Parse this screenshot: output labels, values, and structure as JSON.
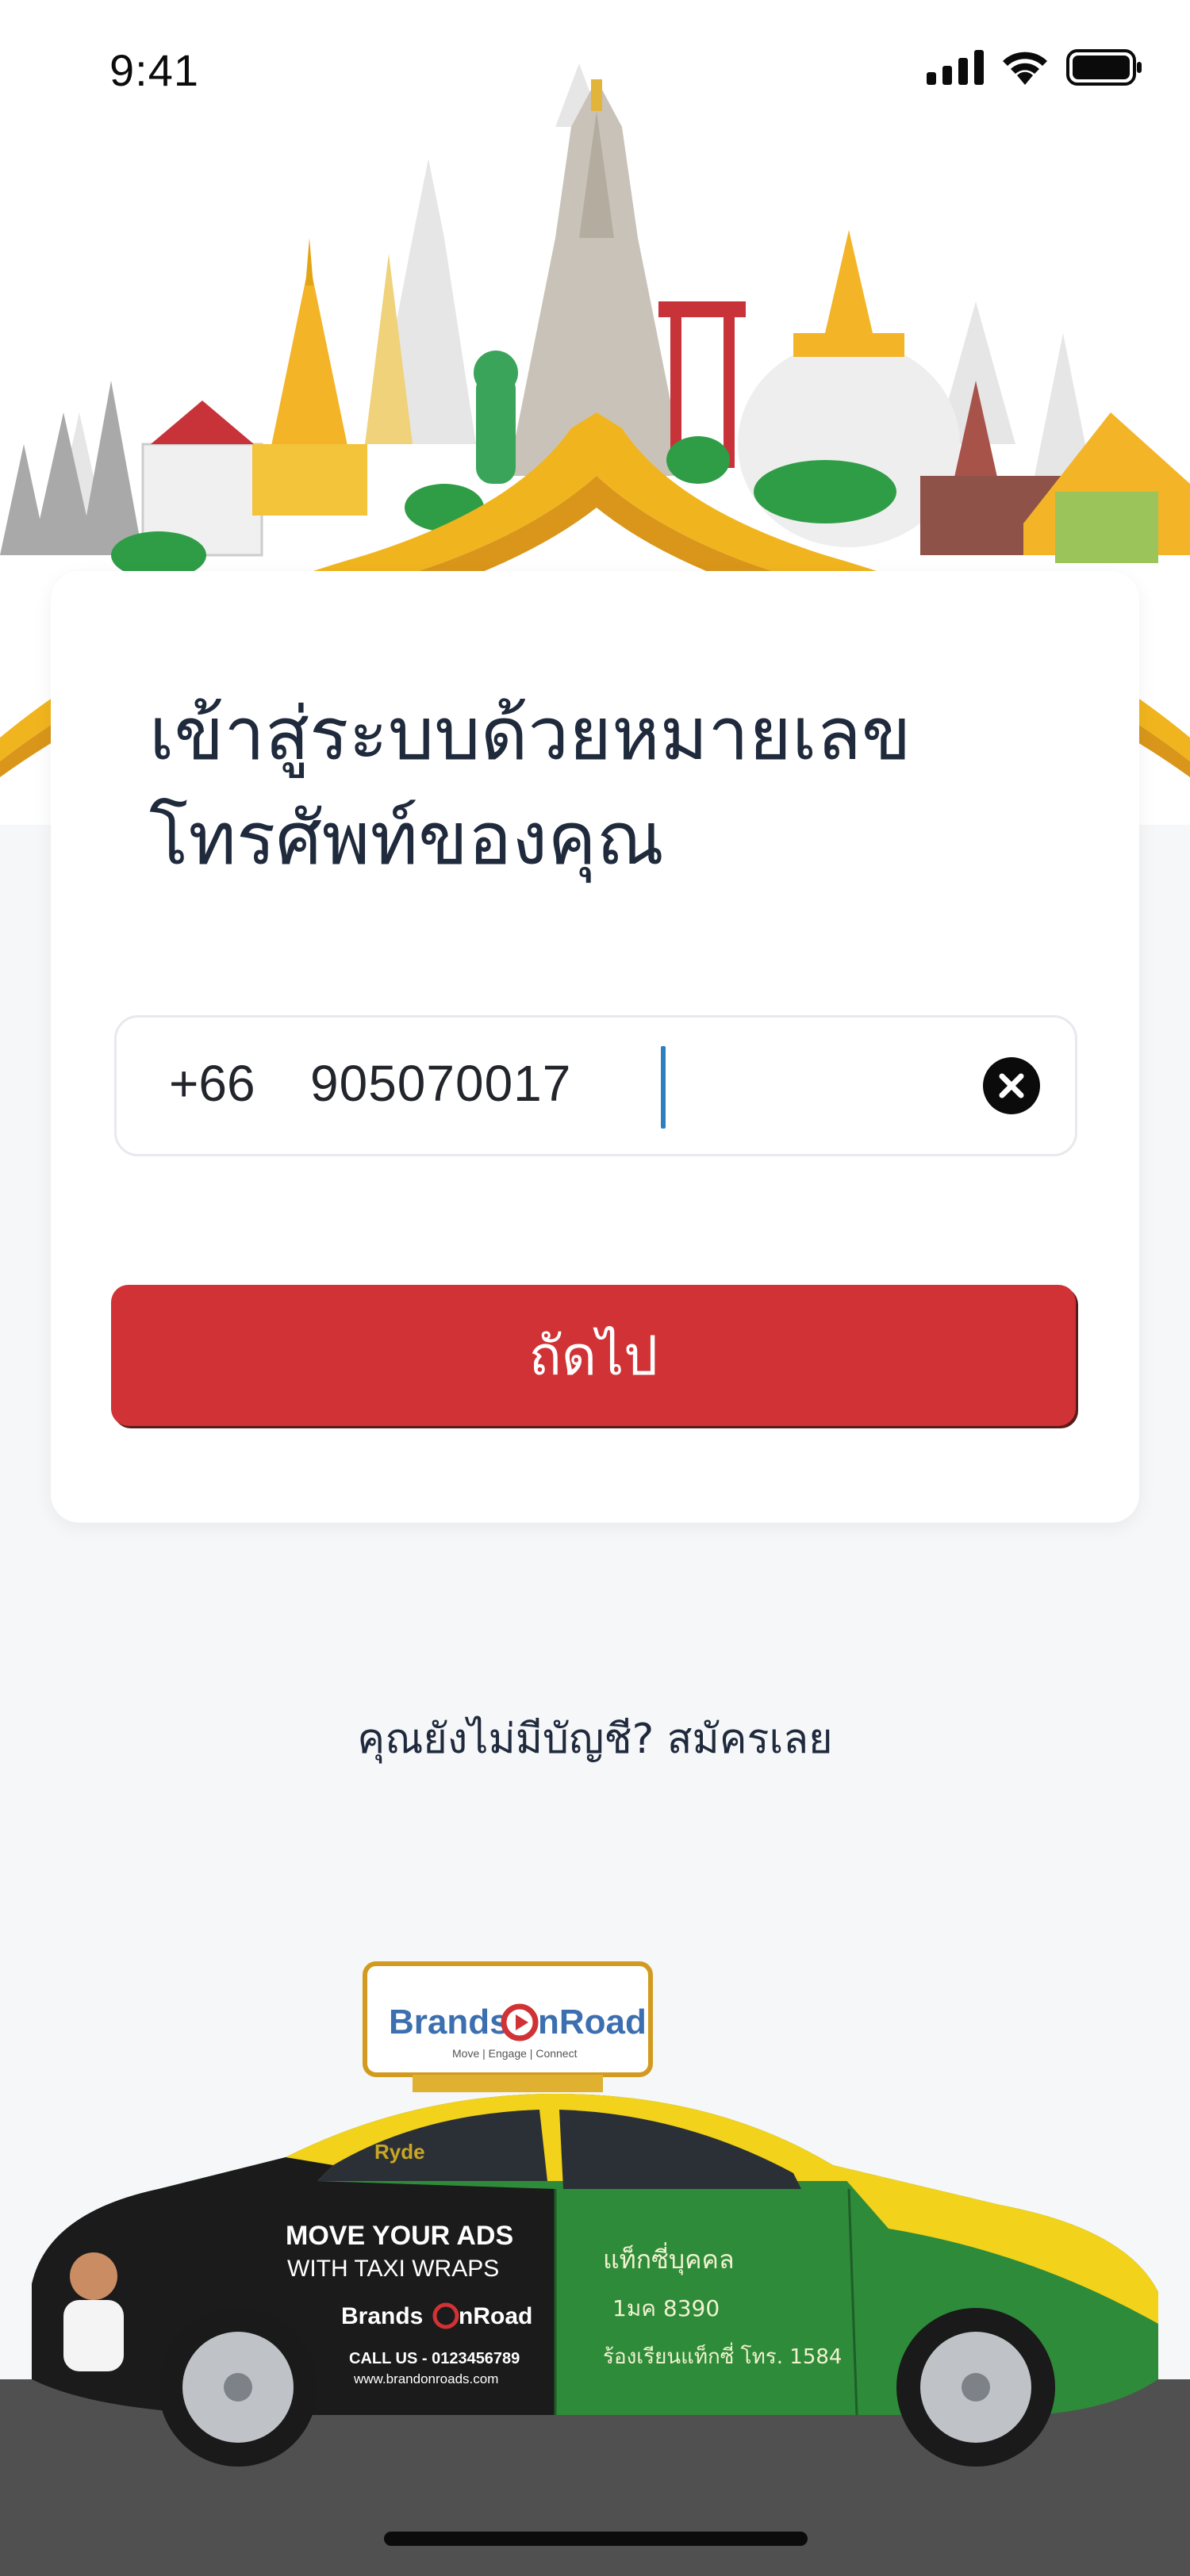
{
  "status_bar": {
    "time": "9:41"
  },
  "login": {
    "title_line1": "เข้าสู่ระบบด้วยหมายเลข",
    "title_line2": "โทรศัพท์ของคุณ",
    "country_code": "+66",
    "phone_number": "905070017",
    "next_label": "ถัดไป"
  },
  "signup": {
    "prompt": "คุณยังไม่มีบัญชี?",
    "link": "สมัครเลย"
  },
  "taxi_ad": {
    "brand_part1": "Brands",
    "brand_part2": "nRoad",
    "tagline": "Move | Engage | Connect",
    "headline1": "MOVE YOUR ADS",
    "headline2": "WITH TAXI WRAPS",
    "call": "CALL US - 0123456789",
    "website": "www.brandonroads.com",
    "door_text1": "แท็กซี่บุคคล",
    "door_text2": "1มค 8390",
    "door_text3": "ร้องเรียนแท็กซี่ โทร. 1584",
    "window_ad": "Ryde"
  },
  "colors": {
    "primary_button": "#d03235",
    "title_text": "#1f2a3c",
    "background": "#f6f7f9",
    "caret": "#2f7fbf"
  }
}
